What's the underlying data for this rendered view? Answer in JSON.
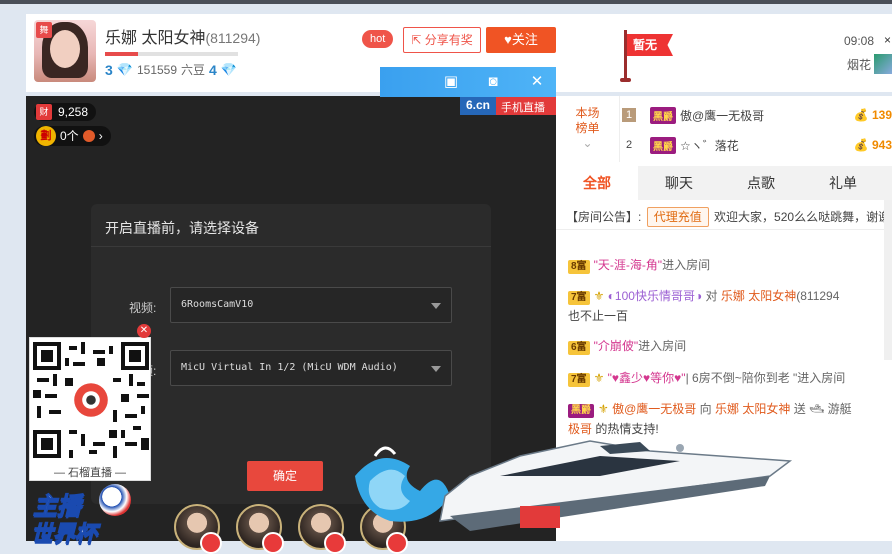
{
  "header": {
    "anchor_name": "乐娜 太阳女神",
    "anchor_id": "(811294)",
    "level_left": "3",
    "level_points": "151559",
    "level_unit": "六豆",
    "level_right": "4",
    "level_progress": 0.25,
    "hot_label": "hot",
    "share_label": "分享有奖",
    "follow_label": "关注",
    "flag_label": "暂无",
    "time": "09:08",
    "gift_name": "烟花",
    "avatar_badge": "舞"
  },
  "video": {
    "logo_6cn": "6.cn",
    "logo_mobile": "手机直播",
    "wealth_icon": "财",
    "wealth_value": "9,258",
    "guard_icon": "劃",
    "guard_count": "0个",
    "toolbar_icons": [
      "window-icon",
      "camera-icon",
      "close-icon"
    ]
  },
  "modal": {
    "title": "开启直播前，请选择设备",
    "video_label": "视频:",
    "video_value": "6RoomsCamV10",
    "audio_label": "音频:",
    "audio_value": "MicU Virtual In 1/2 (MicU WDM Audio)",
    "confirm_label": "确定"
  },
  "qr": {
    "caption": "石榴直播"
  },
  "banner": {
    "line1": "主播",
    "line2": "世界杯"
  },
  "rank": {
    "title_line1": "本场",
    "title_line2": "榜单",
    "rows": [
      {
        "num": "1",
        "name": "傲@鹰一无极哥",
        "value": "139"
      },
      {
        "num": "2",
        "name": "☆ヽ゛落花",
        "value": "943"
      }
    ],
    "vip_label": "黑爵"
  },
  "tabs": [
    "全部",
    "聊天",
    "点歌",
    "礼单"
  ],
  "notice": {
    "label": "【房间公告】:",
    "agent": "代理充值",
    "text": "欢迎大家，520么么哒跳舞，谢谢"
  },
  "chat": [
    {
      "badge": "8富",
      "user": "\"天-涯-海-角\"",
      "text": "进入房间"
    },
    {
      "badge": "7富",
      "user": "◐100快乐情哥哥◑",
      "mid": "对",
      "target": "乐娜 太阳女神",
      "target_id": "(811294",
      "line2": "也不止一百"
    },
    {
      "badge": "6富",
      "user": "\"介崩佊\"",
      "text": "进入房间"
    },
    {
      "badge": "7富",
      "user": "\"♥鑫少♥等你♥\"",
      "text": "| 6房不倒~陪你到老 \"进入房间"
    },
    {
      "badge": "黑爵",
      "user": "傲@鹰一无极哥",
      "mid": "向",
      "target": "乐娜 太阳女神",
      "action": "送",
      "gift": "游艇",
      "line2_user": "极哥",
      "line2": "的热情支持!"
    }
  ]
}
